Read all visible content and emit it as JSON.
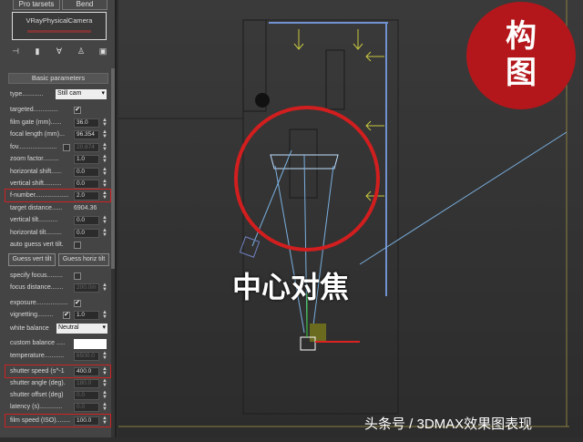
{
  "panel": {
    "top_buttons": [
      "Pro tarsets",
      "Bend"
    ],
    "object_name": "VRayPhysicalCamera",
    "rollout_title": "Basic parameters",
    "params": {
      "type_label": "type............",
      "type_value": "Still cam",
      "targeted_label": "targeted..............",
      "film_gate_label": "film gate (mm)......",
      "film_gate": "36.0",
      "focal_length_label": "focal length (mm)...",
      "focal_length": "96.354",
      "fov_label": "fov......................",
      "fov": "20.874",
      "zoom_factor_label": "zoom factor.........",
      "zoom_factor": "1.0",
      "hshift_label": "horizontal shift......",
      "hshift": "0.0",
      "vshift_label": "vertical shift..........",
      "vshift": "0.0",
      "fnumber_label": "f-number...................",
      "fnumber": "2.0",
      "target_distance_label": "target distance......",
      "target_distance": "6904.36",
      "vtilt_label": "vertical tilt...........",
      "vtilt": "0.0",
      "htilt_label": "horizontal tilt.........",
      "htilt": "0.0",
      "auto_guess_label": "auto guess vert tilt.",
      "guess_vert": "Guess vert tilt",
      "guess_horiz": "Guess horiz tilt",
      "specify_focus_label": "specify focus.........",
      "focus_distance_label": "focus distance.......",
      "focus_distance": "200.0m",
      "exposure_label": "exposure..................",
      "vignetting_label": "vignetting.........",
      "vignetting": "1.0",
      "white_balance_label": "white balance",
      "white_balance": "Neutral",
      "custom_balance_label": "custom balance .....",
      "temperature_label": "temperature...........",
      "temperature": "6500.0",
      "shutter_speed_label": "shutter speed (s^-1",
      "shutter_speed": "400.0",
      "shutter_angle_label": "shutter angle (deg).",
      "shutter_angle": "180.0",
      "shutter_offset_label": "shutter offset (deg)",
      "shutter_offset": "0.0",
      "latency_label": "latency (s).............",
      "latency": "0.0",
      "film_speed_label": "film speed (ISO)........",
      "film_speed": "100.0"
    }
  },
  "overlay": {
    "badge": "构\n图",
    "badge_line1": "构",
    "badge_line2": "图",
    "focus_text": "中心对焦",
    "watermark": "头条号 / 3DMAX效果图表现"
  },
  "colors": {
    "highlight": "#cc2222",
    "badge": "#b3171b"
  }
}
